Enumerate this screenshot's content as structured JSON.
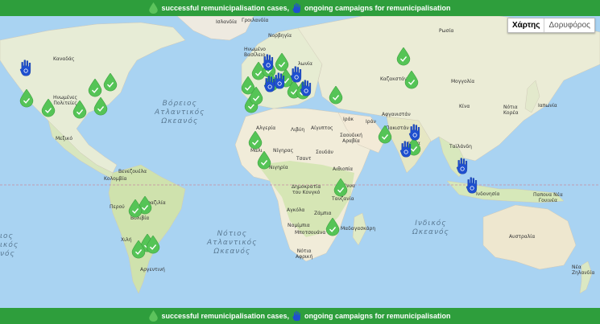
{
  "legend": {
    "success_text": "successful remunicipalisation cases,",
    "campaign_text": "ongoing campaigns for remunicipalisation"
  },
  "map_type": {
    "map": "Χάρτης",
    "satellite": "Δορυφόρος"
  },
  "oceans": {
    "north_atlantic": "Βόρειος\nΑτλαντικός\nΩκεανός",
    "south_atlantic": "Νότιος\nΑτλαντικός\nΩκεανός",
    "indian": "Ινδικός\nΩκεανός",
    "pacific_left": "ιος\nικός\nνός"
  },
  "countries": {
    "greenland": "Γροιλανδία",
    "iceland": "Ισλανδία",
    "norway": "Νορβηγία",
    "uk": "Ηνωμένο\nΒασίλειο",
    "poland": "λωνία",
    "russia": "Ρωσία",
    "kazakhstan": "Καζακστάν",
    "mongolia": "Μογγολία",
    "china": "Κίνα",
    "korea": "Νότια\nΚορέα",
    "japan": "Ιαπωνία",
    "canada": "Καναδάς",
    "usa": "Ηνωμένες\nΠολιτείες",
    "mexico": "Μεξικό",
    "venezuela": "Βενεζουέλα",
    "colombia": "Κολομβία",
    "peru": "Περού",
    "brazil": "Βραζιλία",
    "bolivia": "Βολιβία",
    "chile": "Χιλή",
    "argentina": "Αργεντινή",
    "algeria": "Αλγερία",
    "libya": "Λιβύη",
    "egypt": "Αίγυπτος",
    "mali": "Μάλι",
    "niger": "Νίγηρας",
    "chad": "Τσαντ",
    "sudan": "Σουδάν",
    "nigeria": "Νιγηρία",
    "ethiopia": "Αιθιοπία",
    "drc": "Δημοκρατία\nτου Κονγκό",
    "kenya": "Κένυα",
    "tanzania": "Τανζανία",
    "angola": "Αγκόλα",
    "zambia": "Ζάμπια",
    "namibia": "Ναμίμπια",
    "botswana": "Μποτσουάνα",
    "south_africa": "Νότια\nΑφρική",
    "madagascar": "Μαδαγασκάρη",
    "iraq": "Ιράκ",
    "iran": "Ιράν",
    "saudi": "Σαουδική\nΑραβία",
    "afghanistan": "Αφγανιστάν",
    "pakistan": "Πακιστάν",
    "india": "Ινδία",
    "thailand": "Ταϊλάνδη",
    "indonesia": "Ινδονησία",
    "png": "Παπουα Νέα\nΓουινέα",
    "australia": "Αυστραλία",
    "new_zealand": "Νέα\nΖηλανδία"
  }
}
